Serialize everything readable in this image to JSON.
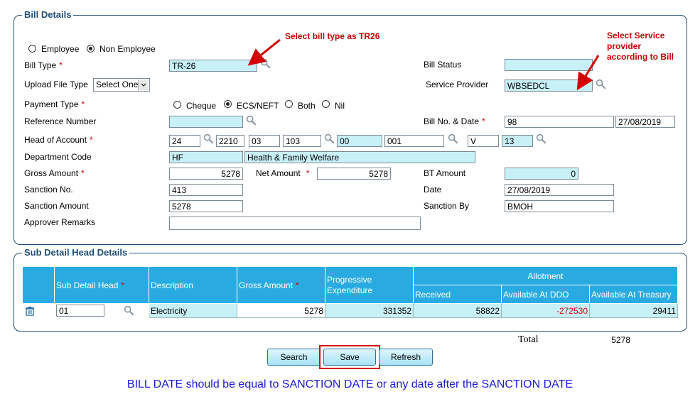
{
  "bill_details": {
    "legend": "Bill Details",
    "employee_label": "Employee",
    "non_employee_label": "Non Employee",
    "bill_type_label": "Bill Type",
    "bill_type_value": "TR-26",
    "bill_status_label": "Bill Status",
    "bill_status_value": "",
    "upload_file_type_label": "Upload File Type",
    "upload_file_type_value": "Select One",
    "service_provider_label": "Service Provider",
    "service_provider_value": "WBSEDCL",
    "payment_type_label": "Payment Type",
    "payment_options": [
      "Cheque",
      "ECS/NEFT",
      "Both",
      "Nil"
    ],
    "reference_number_label": "Reference Number",
    "reference_number_value": "",
    "bill_no_date_label": "Bill No. & Date",
    "bill_no_value": "98",
    "bill_date_value": "27/08/2019",
    "head_of_account_label": "Head of Account",
    "head_of_account_parts": [
      "24",
      "2210",
      "03",
      "103",
      "00",
      "001",
      "V",
      "13"
    ],
    "department_code_label": "Department Code",
    "department_code_value": "HF",
    "department_name_value": "Health & Family Welfare",
    "gross_amount_label": "Gross Amount",
    "gross_amount_value": "5278",
    "net_amount_label": "Net Amount",
    "net_amount_value": "5278",
    "bt_amount_label": "BT Amount",
    "bt_amount_value": "0",
    "sanction_no_label": "Sanction No.",
    "sanction_no_value": "413",
    "date_label": "Date",
    "date_value": "27/08/2019",
    "sanction_amount_label": "Sanction Amount",
    "sanction_amount_value": "5278",
    "sanction_by_label": "Sanction By",
    "sanction_by_value": "BMOH",
    "approver_remarks_label": "Approver Remarks",
    "approver_remarks_value": "",
    "required_mark": "*"
  },
  "annotations": {
    "bill_type_note": "Select bill type as TR26",
    "service_provider_note_lines": [
      "Select Service",
      "provider",
      "according to Bill"
    ]
  },
  "sub_detail": {
    "legend": "Sub Detail Head Details",
    "headers": {
      "sub_detail_head": "Sub Detail Head",
      "description": "Description",
      "gross_amount": "Gross Amount",
      "progressive_expenditure_1": "Progressive",
      "progressive_expenditure_2": "Expenditure",
      "allotment": "Allotment",
      "received": "Received",
      "available_ddo": "Available At DDO",
      "available_treasury": "Available At Treasury"
    },
    "row": {
      "sub_detail_head": "01",
      "description": "Electricity",
      "gross_amount": "5278",
      "progressive_expenditure": "331352",
      "received": "58822",
      "available_ddo": "-272530",
      "available_treasury": "29411"
    }
  },
  "total": {
    "label": "Total",
    "value": "5278"
  },
  "buttons": {
    "search": "Search",
    "save": "Save",
    "refresh": "Refresh"
  },
  "footer_message": "BILL DATE should be equal to SANCTION DATE or any date after the SANCTION DATE",
  "colors": {
    "accent": "#29abe2",
    "input_cyan": "#c8f0f7",
    "annotation_red": "#c40000",
    "footer_blue": "#1a1adb"
  }
}
